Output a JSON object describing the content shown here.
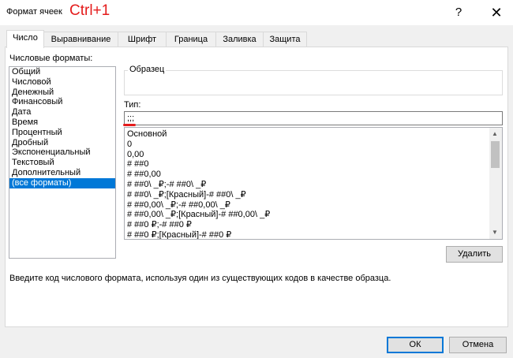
{
  "window": {
    "title": "Формат ячеек",
    "annotation": "Ctrl+1",
    "help_label": "?",
    "close_label": "✕"
  },
  "tabs": [
    {
      "label": "Число",
      "active": true
    },
    {
      "label": "Выравнивание"
    },
    {
      "label": "Шрифт"
    },
    {
      "label": "Граница"
    },
    {
      "label": "Заливка"
    },
    {
      "label": "Защита"
    }
  ],
  "number_formats": {
    "label": "Числовые форматы:",
    "items": [
      "Общий",
      "Числовой",
      "Денежный",
      "Финансовый",
      "Дата",
      "Время",
      "Процентный",
      "Дробный",
      "Экспоненциальный",
      "Текстовый",
      "Дополнительный",
      "(все форматы)"
    ],
    "selected": "(все форматы)"
  },
  "sample": {
    "label": "Образец",
    "value": ""
  },
  "type": {
    "label": "Тип:",
    "value": ";;;",
    "formats": [
      "Основной",
      "0",
      "0,00",
      "# ##0",
      "# ##0,00",
      "# ##0\\ _₽;-# ##0\\ _₽",
      "# ##0\\ _₽;[Красный]-# ##0\\ _₽",
      "# ##0,00\\ _₽;-# ##0,00\\ _₽",
      "# ##0,00\\ _₽;[Красный]-# ##0,00\\ _₽",
      "# ##0 ₽;-# ##0 ₽",
      "# ##0 ₽;[Красный]-# ##0 ₽"
    ]
  },
  "scroll_icons": {
    "up": "▲",
    "down": "▼"
  },
  "delete_label": "Удалить",
  "hint": "Введите код числового формата, используя один из существующих кодов в качестве образца.",
  "ok_label": "ОК",
  "cancel_label": "Отмена",
  "colors": {
    "accent": "#0078d7",
    "annotation": "#e41b1b"
  }
}
